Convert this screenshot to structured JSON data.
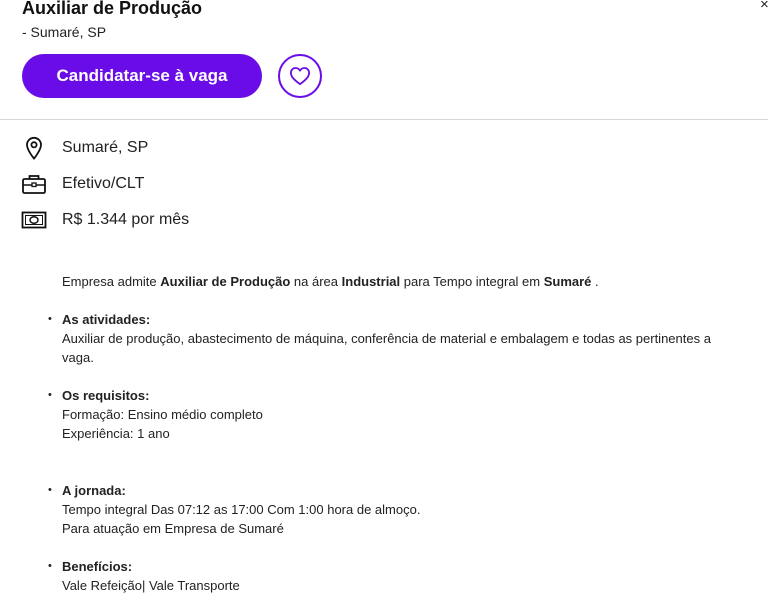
{
  "job": {
    "title": "Auxiliar de Produção",
    "location_line": "- Sumaré, SP",
    "close_symbol": "×",
    "apply_label": "Candidatar-se à vaga"
  },
  "details": {
    "location": "Sumaré, SP",
    "contract": "Efetivo/CLT",
    "salary": "R$ 1.344 por mês"
  },
  "description": {
    "intro": {
      "p1": "Empresa admite ",
      "role": "Auxiliar de Produção",
      "p2": " na área ",
      "area": "Industrial",
      "p3": " para Tempo integral em ",
      "city": "Sumaré",
      "p4": " ."
    },
    "sections": [
      {
        "title": "As atividades:",
        "lines": [
          "Auxiliar de produção, abastecimento de máquina, conferência de material e embalagem e todas as pertinentes a vaga."
        ]
      },
      {
        "title": "Os requisitos:",
        "lines": [
          "Formação: Ensino médio completo",
          "Experiência: 1 ano"
        ]
      },
      {
        "title": "A jornada:",
        "lines": [
          "Tempo integral Das 07:12 as 17:00 Com 1:00 hora de almoço.",
          "Para atuação em Empresa de Sumaré"
        ]
      },
      {
        "title": "Benefícios:",
        "lines": [
          "Vale Refeição| Vale Transporte"
        ]
      }
    ]
  },
  "icons": {
    "location": "map-pin-icon",
    "contract": "briefcase-icon",
    "salary": "banknote-icon",
    "favorite": "heart-icon",
    "close": "close-icon"
  },
  "colors": {
    "accent": "#6a0ce8",
    "divider": "#d7d7d7",
    "text": "#1a1a1a"
  }
}
